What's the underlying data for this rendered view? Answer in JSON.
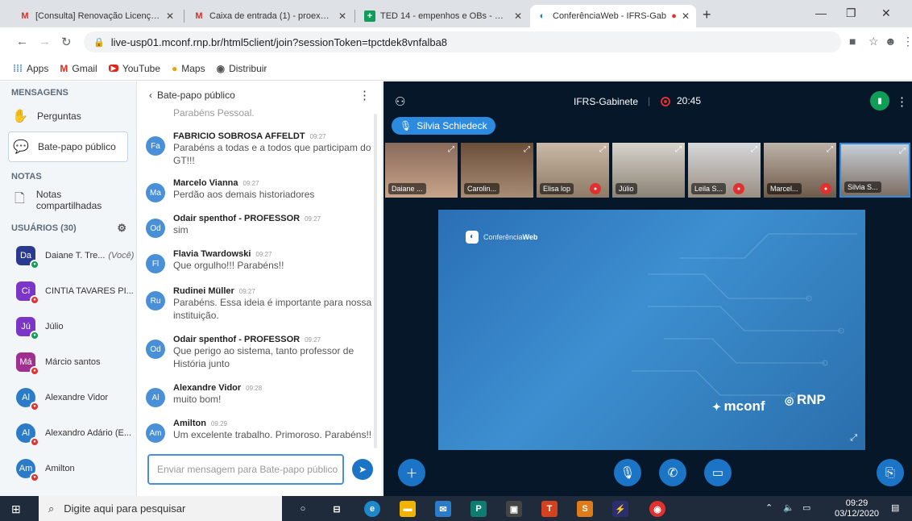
{
  "browser": {
    "tabs": [
      {
        "title": "[Consulta] Renovação Licença Pa",
        "icon": "gmail-icon",
        "favicon": "M",
        "color": "#d93025"
      },
      {
        "title": "Caixa de entrada (1) - proex@ifr",
        "icon": "gmail-icon",
        "favicon": "M",
        "color": "#d93025"
      },
      {
        "title": "TED 14 - empenhos e OBs - Plan",
        "icon": "sheets-icon",
        "favicon": "+",
        "color": "#0f9d58"
      },
      {
        "title": "ConferênciaWeb - IFRS-Gab",
        "icon": "conferenciaweb-icon",
        "favicon": "◐",
        "color": "#1b74c5"
      }
    ],
    "url": "live-usp01.mconf.rnp.br/html5client/join?sessionToken=tpctdek8vnfalba8",
    "bookmarks": [
      {
        "label": "Apps",
        "icon": "apps-grid-icon",
        "glyph": "⋮⋮"
      },
      {
        "label": "Gmail",
        "icon": "gmail-icon",
        "glyph": "M"
      },
      {
        "label": "YouTube",
        "icon": "youtube-icon",
        "glyph": "▶"
      },
      {
        "label": "Maps",
        "icon": "maps-pin-icon",
        "glyph": "📍"
      },
      {
        "label": "Distribuir",
        "icon": "globe-icon",
        "glyph": "◉"
      }
    ]
  },
  "sidebar": {
    "messages_header": "MENSAGENS",
    "items": [
      {
        "label": "Perguntas",
        "icon": "hand-icon"
      },
      {
        "label": "Bate-papo público",
        "icon": "chat-bubble-icon"
      }
    ],
    "notes_header": "NOTAS",
    "notes_item": "Notas compartilhadas",
    "users_header": "USUÁRIOS (30)",
    "you_label": "(Você)",
    "users": [
      {
        "initials": "Da",
        "name": "Daiane T. Tre...",
        "color": "#2a3a8f",
        "mic": "#0f9d58",
        "shape": "square"
      },
      {
        "initials": "Ci",
        "name": "CINTIA TAVARES PI...",
        "color": "#7b35c7",
        "mic": "#e03131",
        "shape": "square"
      },
      {
        "initials": "Jú",
        "name": "Júlio",
        "color": "#7b35c7",
        "mic": "#0f9d58",
        "shape": "square"
      },
      {
        "initials": "Má",
        "name": "Márcio santos",
        "color": "#a0308f",
        "mic": "#e03131",
        "shape": "square"
      },
      {
        "initials": "Al",
        "name": "Alexandre Vidor",
        "color": "#2b7bc9",
        "mic": "#e03131",
        "shape": "round"
      },
      {
        "initials": "Al",
        "name": "Alexandro Adário (E...",
        "color": "#2b7bc9",
        "mic": "#e03131",
        "shape": "round"
      },
      {
        "initials": "Am",
        "name": "Amilton",
        "color": "#2b7bc9",
        "mic": "#e03131",
        "shape": "round"
      }
    ]
  },
  "chat": {
    "title": "Bate-papo público",
    "partial_text": "Parabéns Pessoal.",
    "messages": [
      {
        "initials": "Fa",
        "name": "FABRICIO SOBROSA AFFELDT",
        "time": "09:27",
        "text": "Parabéns a todas e a todos que participam do GT!!!"
      },
      {
        "initials": "Ma",
        "name": "Marcelo Vianna",
        "time": "09:27",
        "text": "Perdão aos demais historiadores"
      },
      {
        "initials": "Od",
        "name": "Odair spenthof - PROFESSOR",
        "time": "09:27",
        "text": "sim"
      },
      {
        "initials": "Fl",
        "name": "Flavia Twardowski",
        "time": "09:27",
        "text": "Que orgulho!!! Parabéns!!"
      },
      {
        "initials": "Ru",
        "name": "Rudinei Müller",
        "time": "09:27",
        "text": "Parabéns. Essa ideia é importante para nossa instituição."
      },
      {
        "initials": "Od",
        "name": "Odair spenthof - PROFESSOR",
        "time": "09:27",
        "text": "Que perigo ao sistema, tanto professor de História junto"
      },
      {
        "initials": "Al",
        "name": "Alexandre Vidor",
        "time": "09:28",
        "text": "muito bom!"
      },
      {
        "initials": "Am",
        "name": "Amilton",
        "time": "09:29",
        "text": "Um excelente trabalho. Primoroso. Parabéns!!"
      }
    ],
    "input_placeholder": "Enviar mensagem para Bate-papo público"
  },
  "stage": {
    "room": "IFRS-Gabinete",
    "timer": "20:45",
    "talking": "Silvia Schiedeck",
    "videos": [
      {
        "label": "Daiane ...",
        "muted": false
      },
      {
        "label": "Carolin...",
        "muted": false
      },
      {
        "label": "Elisa lop",
        "muted": true
      },
      {
        "label": "Júlio",
        "muted": true
      },
      {
        "label": "Leila S...",
        "muted": true
      },
      {
        "label": "Marcel...",
        "muted": true
      },
      {
        "label": "Silvia S...",
        "muted": false
      }
    ],
    "slide": {
      "brand_prefix": "Conferência",
      "brand_suffix": "Web",
      "mconf": "mconf",
      "rnp": "RNP"
    }
  },
  "taskbar": {
    "search_placeholder": "Digite aqui para pesquisar",
    "time": "09:29",
    "date": "03/12/2020"
  }
}
